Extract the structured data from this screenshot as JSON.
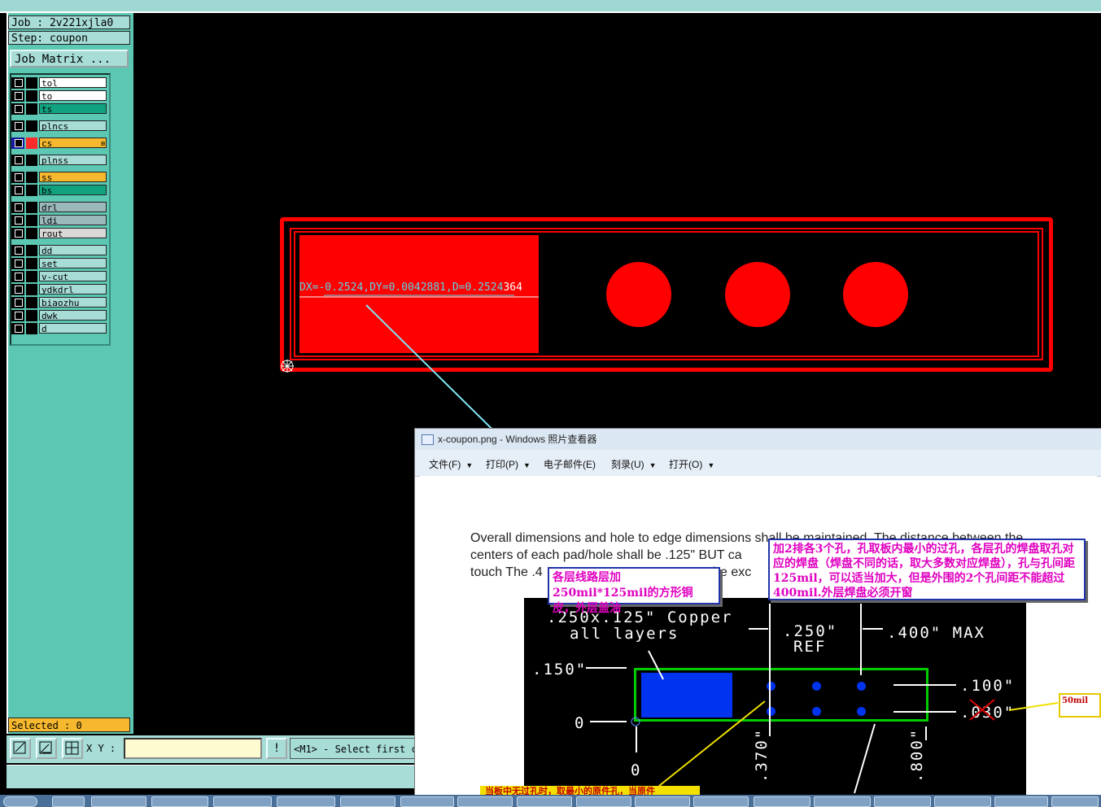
{
  "job": {
    "label": "Job : 2v221xjla0",
    "step": "Step: coupon",
    "matrix_button": "Job Matrix ..."
  },
  "layers": [
    {
      "name": "tol",
      "color": "#ffffff"
    },
    {
      "name": "to",
      "color": "#ffffff"
    },
    {
      "name": "ts",
      "color": "#11a37f"
    },
    {
      "name": "plncs",
      "color": "#a7dcd7"
    },
    {
      "name": "cs",
      "color": "#f5b82e",
      "active": true
    },
    {
      "name": "plnss",
      "color": "#a7dcd7"
    },
    {
      "name": "ss",
      "color": "#f5b82e"
    },
    {
      "name": "bs",
      "color": "#11a37f"
    },
    {
      "name": "drl",
      "color": "#9bb8bb"
    },
    {
      "name": "ldi",
      "color": "#9bb8bb"
    },
    {
      "name": "rout",
      "color": "#d8d8d8"
    },
    {
      "name": "dd",
      "color": "#a7dcd7"
    },
    {
      "name": "set",
      "color": "#a7dcd7"
    },
    {
      "name": "v-cut",
      "color": "#a7dcd7"
    },
    {
      "name": "ydkdrl",
      "color": "#a7dcd7"
    },
    {
      "name": "biaozhu",
      "color": "#a7dcd7"
    },
    {
      "name": "dwk",
      "color": "#a7dcd7"
    },
    {
      "name": "d",
      "color": "#a7dcd7"
    }
  ],
  "selected": "Selected : 0",
  "toolbar": {
    "xy_label": "X Y :",
    "xy_value": "",
    "info_button": "!",
    "message": "<M1> - Select first co"
  },
  "canvas": {
    "measure_text": "DX=-0.2524,DY=0.0042881,D=0.2524",
    "measure_tail": "364"
  },
  "photo_viewer": {
    "title": "x-coupon.png - Windows 照片查看器",
    "menus": [
      "文件(F)",
      "打印(P)",
      "电子邮件(E)",
      "刻录(U)",
      "打开(O)"
    ],
    "doc_text": [
      "Overall dimensions and hole to edge dimensions shall be maintained. The distance between the",
      "centers of each pad/hole shall be .125\" BUT ca",
      "touch The .4",
      " be exc"
    ],
    "figure_labels": {
      "copper": ".250x.125\" Copper",
      "layers": "all layers",
      "ref_val": ".250\"",
      "ref": "REF",
      "max": ".400\" MAX",
      "y150": ".150\"",
      "y0": "0",
      "y100": ".100\"",
      "y030": ".030\"",
      "x0": "0",
      "x370": ".370\"",
      "x800": ".800\""
    },
    "callout1": "各层线路层加250mil*125mil的方形铜皮，外层盖油",
    "callout2": "加2排各3个孔，孔取板内最小的过孔，各层孔的焊盘取孔对应的焊盘（焊盘不同的话，取大多数对应焊盘），孔与孔间距125mil，可以适当加大，但是外围的2个孔间距不能超过400mil.外层焊盘必须开窗",
    "callout3": "50mil",
    "callout4": "当板中无过孔时，取最小的原件孔，当原件"
  },
  "colors": {
    "teal_panel": "#5cc8b3",
    "light_teal": "#a7dcd7",
    "orange": "#f5b82e",
    "red": "#ff0000",
    "cyan_line": "#59d6e6"
  }
}
